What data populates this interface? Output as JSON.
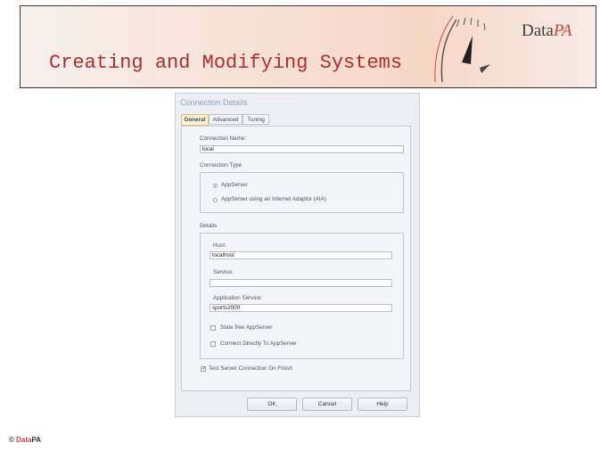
{
  "slide": {
    "title": "Creating and Modifying Systems",
    "logo_data": "Data",
    "logo_pa": "PA",
    "footer_copy": "©",
    "footer_data": "Data",
    "footer_pa": "PA"
  },
  "dialog": {
    "title": "Connection Details",
    "tabs": [
      "General",
      "Advanced",
      "Tuning"
    ],
    "active_tab": "General",
    "connection_name_label": "Connection Name:",
    "connection_name_value": "local",
    "connection_type_label": "Connection Type",
    "radio_appserver": "AppServer",
    "radio_aia": "AppServer using an Internet Adaptor (AIA)",
    "details_label": "Details",
    "host_label": "Host:",
    "host_value": "localhost",
    "service_label": "Service:",
    "service_value": "",
    "app_service_label": "Application Service:",
    "app_service_value": "sports2000",
    "check_state_free": "State free AppServer",
    "check_connect_direct": "Connect Directly To AppServer",
    "check_test_conn": "Test Server Connection On Finish",
    "ok_label": "OK",
    "cancel_label": "Cancel",
    "help_label": "Help"
  },
  "colors": {
    "title": "#b02e2e",
    "accent": "#c8463c"
  }
}
